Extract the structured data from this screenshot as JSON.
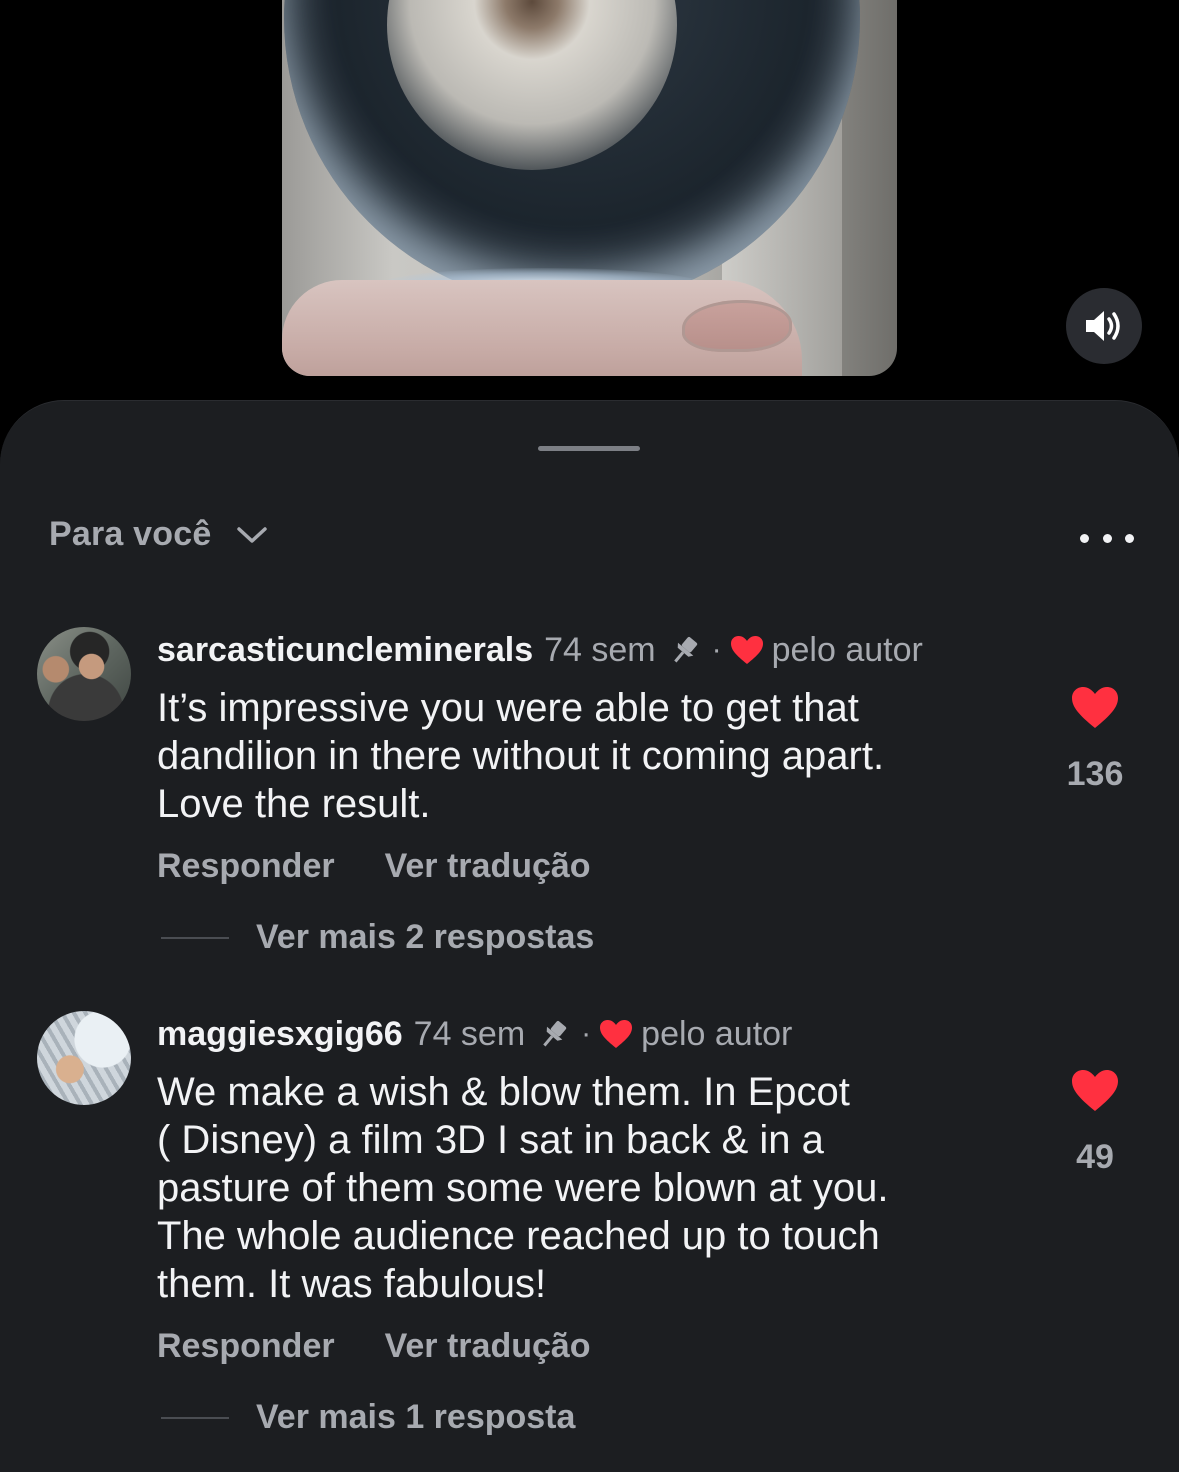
{
  "sheet": {
    "sort_label": "Para você"
  },
  "comments": [
    {
      "username": "sarcasticuncleminerals",
      "time": "74 sem",
      "separator": "·",
      "author_label": "pelo autor",
      "text": "It’s impressive you were able to get that\ndandilion in there without it coming apart.\nLove the result.",
      "reply_label": "Responder",
      "translate_label": "Ver tradução",
      "more_replies_label": "Ver mais 2 respostas",
      "likes": "136"
    },
    {
      "username": "maggiesxgig66",
      "time": "74 sem",
      "separator": "·",
      "author_label": "pelo autor",
      "text": "We make a wish & blow them. In Epcot\n( Disney) a film 3D I sat in back & in a\npasture of them some were blown at you.\nThe whole audience reached up to touch\nthem. It was fabulous!",
      "reply_label": "Responder",
      "translate_label": "Ver tradução",
      "more_replies_label": "Ver mais 1 resposta",
      "likes": "49"
    }
  ],
  "colors": {
    "like_red": "#ff3040",
    "sheet_bg": "#1c1e21",
    "secondary_text": "#a7aab0"
  },
  "icons": {
    "sound": "speaker-icon",
    "sort": "chevron-down-icon",
    "more": "more-options-icon",
    "pin": "pin-icon",
    "heart": "heart-icon"
  }
}
